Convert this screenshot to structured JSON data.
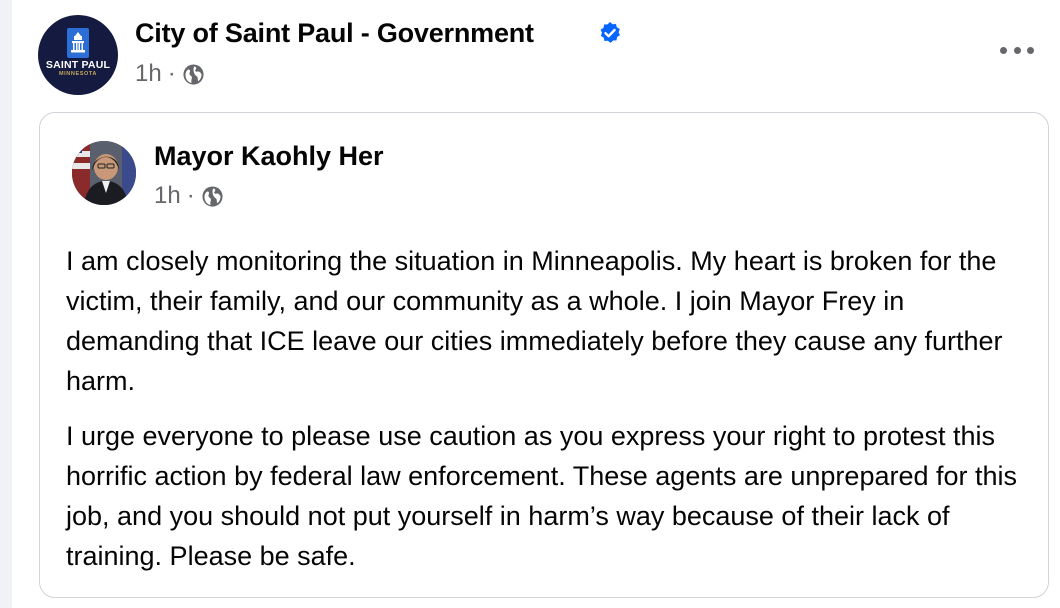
{
  "page": {
    "name": "City of Saint Paul - Government",
    "time": "1h",
    "separator": "·",
    "audience_icon": "globe-icon",
    "verified_icon": "verified-badge-icon",
    "logo": {
      "line1": "SAINT PAUL",
      "line2": "MINNESOTA"
    }
  },
  "shared_post": {
    "author": "Mayor Kaohly Her",
    "time": "1h",
    "separator": "·",
    "paragraphs": [
      "I am closely monitoring the situation in Minneapolis. My heart is broken for the victim, their family, and our community as a whole. I join Mayor Frey in demanding that ICE leave our cities immediately before they cause any further harm.",
      "I urge everyone to please use caution as you express your right to protest this horrific action by federal law enforcement. These agents are unprepared for this job, and you should not put yourself in harm’s way because of their lack of training. Please be safe."
    ]
  },
  "colors": {
    "text": "#050505",
    "secondary": "#65676b",
    "verified": "#0866ff",
    "logo_bg": "#141a40",
    "logo_gold": "#c8a85a",
    "border": "#d0d3d8"
  }
}
